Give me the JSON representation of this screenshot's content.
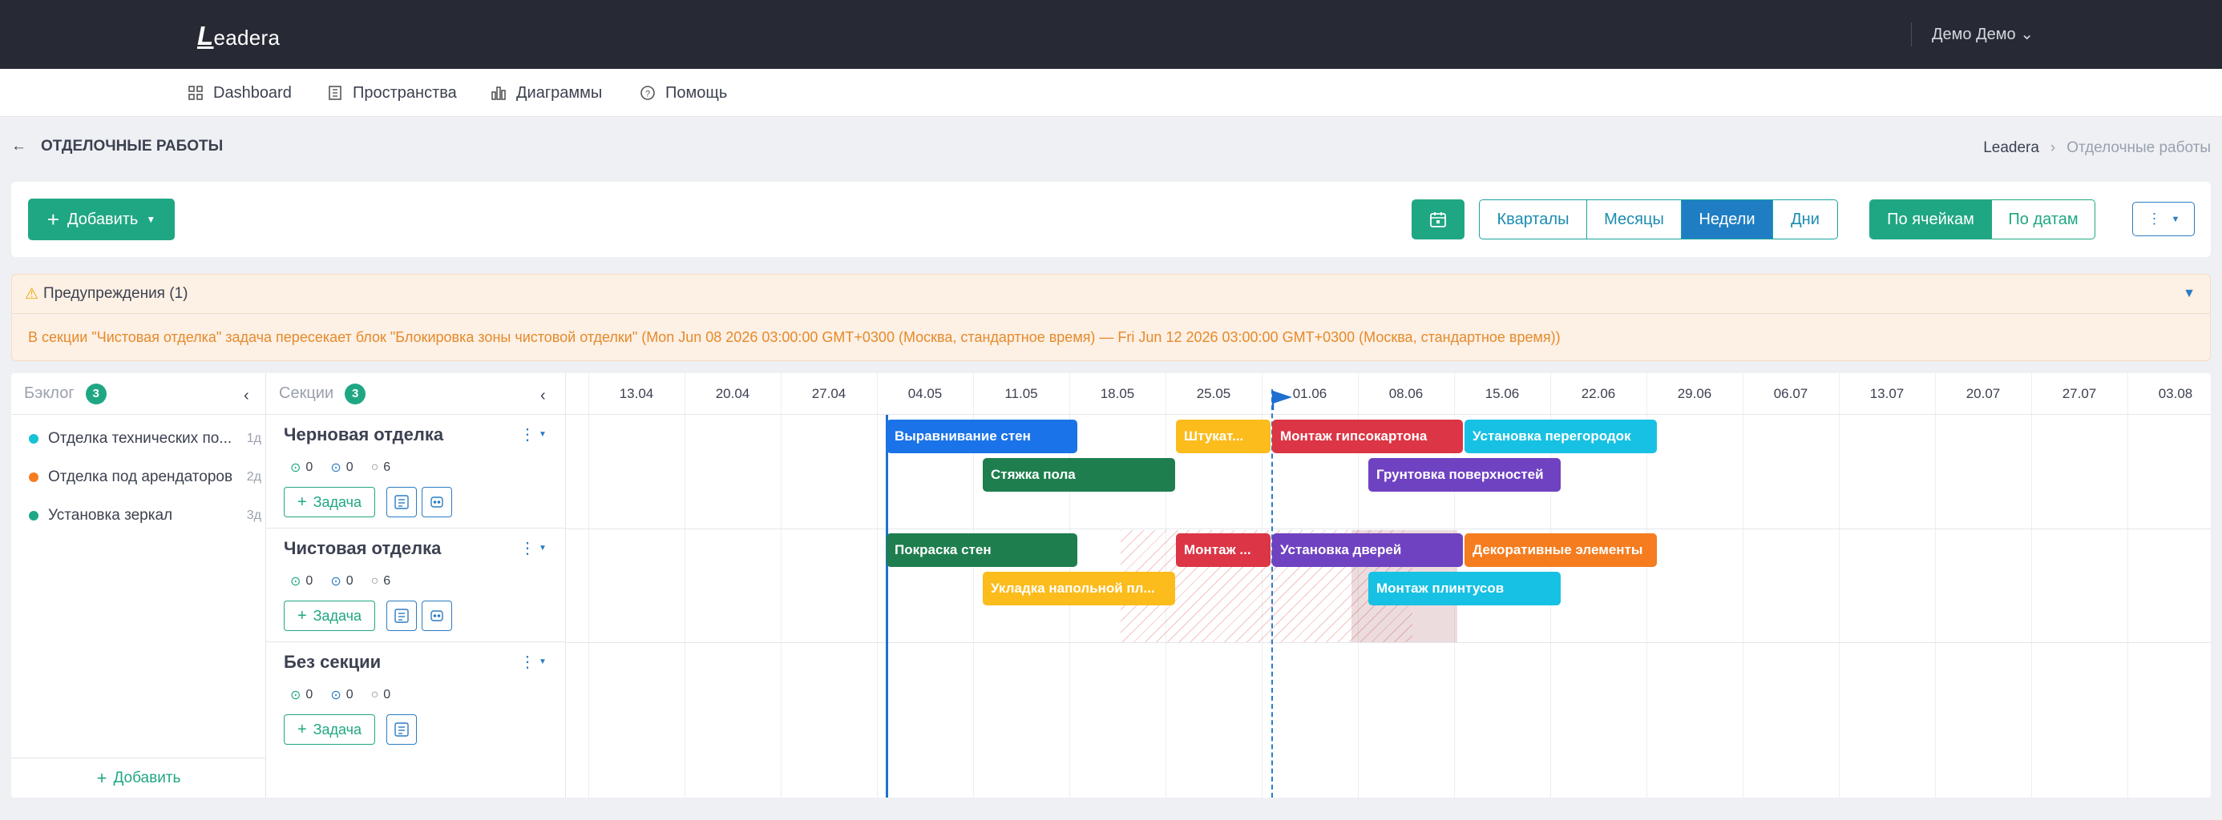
{
  "header": {
    "logo_initial": "L",
    "logo_rest": "eadera",
    "user": "Демо Демо"
  },
  "menu": [
    {
      "label": "Dashboard",
      "icon": "dashboard-icon"
    },
    {
      "label": "Пространства",
      "icon": "building-icon"
    },
    {
      "label": "Диаграммы",
      "icon": "chart-icon"
    },
    {
      "label": "Помощь",
      "icon": "help-icon"
    }
  ],
  "page": {
    "title": "ОТДЕЛОЧНЫЕ РАБОТЫ",
    "breadcrumb": [
      "Leadera",
      "Отделочные работы"
    ]
  },
  "toolbar": {
    "add_label": "Добавить",
    "scale": [
      "Кварталы",
      "Месяцы",
      "Недели",
      "Дни"
    ],
    "scale_active": "Недели",
    "mode": [
      "По ячейкам",
      "По датам"
    ],
    "mode_active": "По ячейкам"
  },
  "warnings": {
    "title": "Предупреждения (1)",
    "text": "В секции \"Чистовая отделка\" задача пересекает блок \"Блокировка зоны чистовой отделки\" (Mon Jun 08 2026 03:00:00 GMT+0300 (Москва, стандартное время) — Fri Jun 12 2026 03:00:00 GMT+0300 (Москва, стандартное время))"
  },
  "backlog": {
    "title": "Бэклог",
    "count": "3",
    "add_label": "Добавить",
    "items": [
      {
        "label": "Отделка технических по...",
        "dur": "1д",
        "color": "#17c1d6"
      },
      {
        "label": "Отделка под арендаторов",
        "dur": "2д",
        "color": "#f57c1f"
      },
      {
        "label": "Установка зеркал",
        "dur": "3д",
        "color": "#1fa783"
      }
    ]
  },
  "sections_panel": {
    "title": "Секции",
    "count": "3",
    "task_label": "Задача",
    "sections": [
      {
        "title": "Черновая отделка",
        "done": "0",
        "in_progress": "0",
        "total": "6"
      },
      {
        "title": "Чистовая отделка",
        "done": "0",
        "in_progress": "0",
        "total": "6"
      },
      {
        "title": "Без секции",
        "done": "0",
        "in_progress": "0",
        "total": "0"
      }
    ]
  },
  "timeline": {
    "dates": [
      "13.04",
      "20.04",
      "27.04",
      "04.05",
      "11.05",
      "18.05",
      "25.05",
      "01.06",
      "08.06",
      "15.06",
      "22.06",
      "29.06",
      "06.07",
      "13.07",
      "20.07",
      "27.07",
      "03.08"
    ],
    "tasks": [
      {
        "label": "Выравнивание стен",
        "color": "#1a73e8",
        "section": 0
      },
      {
        "label": "Штукат...",
        "color": "#fbbc1c",
        "section": 0
      },
      {
        "label": "Монтаж гипсокартона",
        "color": "#dc3545",
        "section": 0
      },
      {
        "label": "Установка перегородок",
        "color": "#17c1e3",
        "section": 0
      },
      {
        "label": "Стяжка пола",
        "color": "#1e7e4e",
        "section": 0
      },
      {
        "label": "Грунтовка поверхностей",
        "color": "#6f42c1",
        "section": 0
      },
      {
        "label": "Покраска стен",
        "color": "#1e7e4e",
        "section": 1
      },
      {
        "label": "Монтаж ...",
        "color": "#dc3545",
        "section": 1
      },
      {
        "label": "Установка дверей",
        "color": "#6f42c1",
        "section": 1
      },
      {
        "label": "Декоративные элементы",
        "color": "#f57c1f",
        "section": 1
      },
      {
        "label": "Укладка напольной пл...",
        "color": "#fbbc1c",
        "section": 1
      },
      {
        "label": "Монтаж плинтусов",
        "color": "#17c1e3",
        "section": 1
      }
    ]
  }
}
